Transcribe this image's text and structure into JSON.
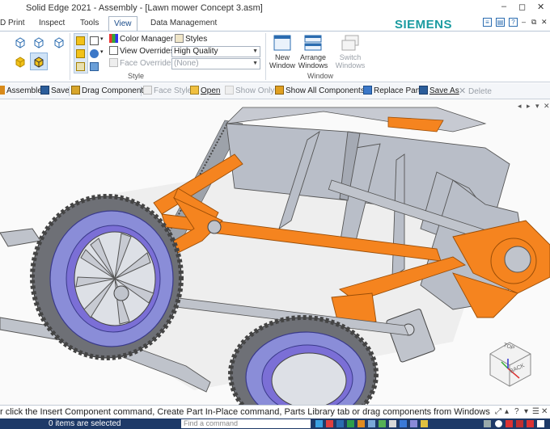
{
  "window": {
    "title": "Solid Edge 2021 - Assembly - [Lawn mower Concept 3.asm]",
    "controls": [
      "–",
      "◻",
      "✕"
    ]
  },
  "tabs": [
    {
      "label": "D Print"
    },
    {
      "label": "Inspect"
    },
    {
      "label": "Tools"
    },
    {
      "label": "View",
      "active": true
    },
    {
      "label": "Data Management"
    }
  ],
  "brand": "SIEMENS",
  "ribbon": {
    "style": {
      "color_manager": "Color Manager",
      "view_overrides": "View Overrides",
      "face_overrides": "Face Overrides",
      "styles": "Styles",
      "quality_value": "High Quality",
      "style_value": "(None)",
      "group_label": "Style"
    },
    "window": {
      "new_window_1": "New",
      "new_window_2": "Window",
      "arrange_1": "Arrange",
      "arrange_2": "Windows",
      "switch_1": "Switch",
      "switch_2": "Windows",
      "group_label": "Window"
    }
  },
  "command_bar": {
    "assemble": "Assemble",
    "save": "Save",
    "drag_component": "Drag Component",
    "face_style": "Face Style",
    "open": "Open",
    "show_only": "Show Only",
    "show_all": "Show All Components",
    "replace_part": "Replace Part",
    "save_as": "Save As",
    "delete": "Delete"
  },
  "viewcube": {
    "top_label": "TOP",
    "back_label": "BACK"
  },
  "prompt": "r click the Insert Component command, Create Part In-Place command, Parts Library tab or drag components from Windows",
  "status": {
    "selected": "0 items are selected",
    "find_placeholder": "Find a command"
  },
  "colors": {
    "accent": "#1a4c8a",
    "brand": "#1a9ba0",
    "status_bar": "#1e3a68",
    "orange_part": "#f5841f",
    "purple_part": "#7b6fd6",
    "grey_part": "#b9bec8"
  }
}
